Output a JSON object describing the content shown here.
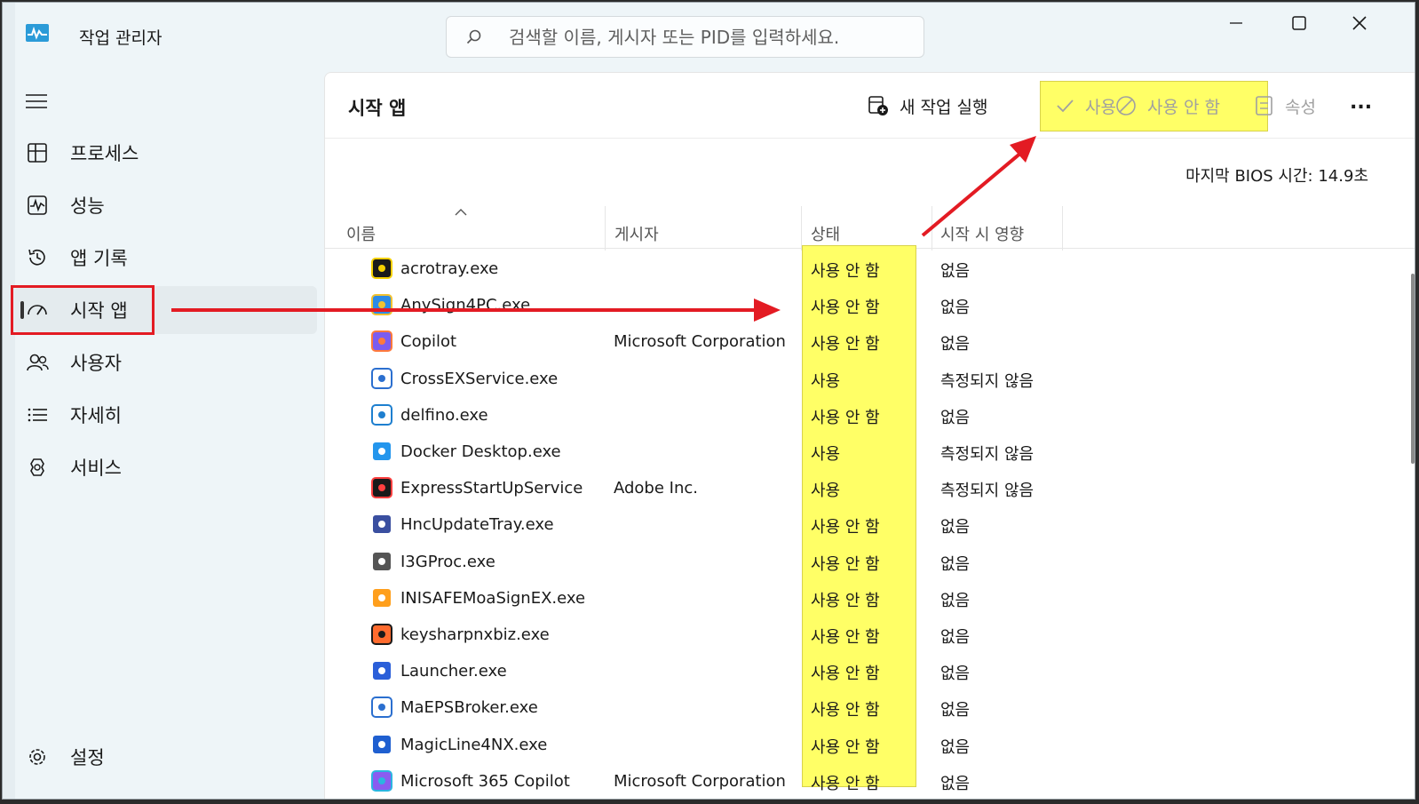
{
  "app": {
    "title": "작업 관리자",
    "search_placeholder": "검색할 이름, 게시자 또는 PID를 입력하세요."
  },
  "sidebar": {
    "items": [
      {
        "label": "프로세스",
        "icon": "processes-icon"
      },
      {
        "label": "성능",
        "icon": "performance-icon"
      },
      {
        "label": "앱 기록",
        "icon": "history-icon"
      },
      {
        "label": "시작 앱",
        "icon": "startup-icon",
        "selected": true
      },
      {
        "label": "사용자",
        "icon": "users-icon"
      },
      {
        "label": "자세히",
        "icon": "details-icon"
      },
      {
        "label": "서비스",
        "icon": "services-icon"
      }
    ],
    "settings_label": "설정"
  },
  "toolbar": {
    "page_title": "시작 앱",
    "run_task_label": "새 작업 실행",
    "enable_label": "사용",
    "disable_label": "사용 안 함",
    "properties_label": "속성",
    "more": "..."
  },
  "bios": {
    "label": "마지막 BIOS 시간:",
    "value": "14.9초"
  },
  "table": {
    "columns": [
      "이름",
      "게시자",
      "상태",
      "시작 시 영향"
    ],
    "rows": [
      {
        "name": "acrotray.exe",
        "publisher": "",
        "status": "사용 안 함",
        "impact": "없음"
      },
      {
        "name": "AnySign4PC.exe",
        "publisher": "",
        "status": "사용 안 함",
        "impact": "없음"
      },
      {
        "name": "Copilot",
        "publisher": "Microsoft Corporation",
        "status": "사용 안 함",
        "impact": "없음"
      },
      {
        "name": "CrossEXService.exe",
        "publisher": "",
        "status": "사용",
        "impact": "측정되지 않음"
      },
      {
        "name": "delfino.exe",
        "publisher": "",
        "status": "사용 안 함",
        "impact": "없음"
      },
      {
        "name": "Docker Desktop.exe",
        "publisher": "",
        "status": "사용",
        "impact": "측정되지 않음"
      },
      {
        "name": "ExpressStartUpService",
        "publisher": "Adobe Inc.",
        "status": "사용",
        "impact": "측정되지 않음"
      },
      {
        "name": "HncUpdateTray.exe",
        "publisher": "",
        "status": "사용 안 함",
        "impact": "없음"
      },
      {
        "name": "I3GProc.exe",
        "publisher": "",
        "status": "사용 안 함",
        "impact": "없음"
      },
      {
        "name": "INISAFEMoaSignEX.exe",
        "publisher": "",
        "status": "사용 안 함",
        "impact": "없음"
      },
      {
        "name": "keysharpnxbiz.exe",
        "publisher": "",
        "status": "사용 안 함",
        "impact": "없음"
      },
      {
        "name": "Launcher.exe",
        "publisher": "",
        "status": "사용 안 함",
        "impact": "없음"
      },
      {
        "name": "MaEPSBroker.exe",
        "publisher": "",
        "status": "사용 안 함",
        "impact": "없음"
      },
      {
        "name": "MagicLine4NX.exe",
        "publisher": "",
        "status": "사용 안 함",
        "impact": "없음"
      },
      {
        "name": "Microsoft 365 Copilot",
        "publisher": "Microsoft Corporation",
        "status": "사용 안 함",
        "impact": "없음"
      }
    ]
  },
  "colors": {
    "highlight": "#ffff66",
    "annotation_red": "#e31b23"
  }
}
